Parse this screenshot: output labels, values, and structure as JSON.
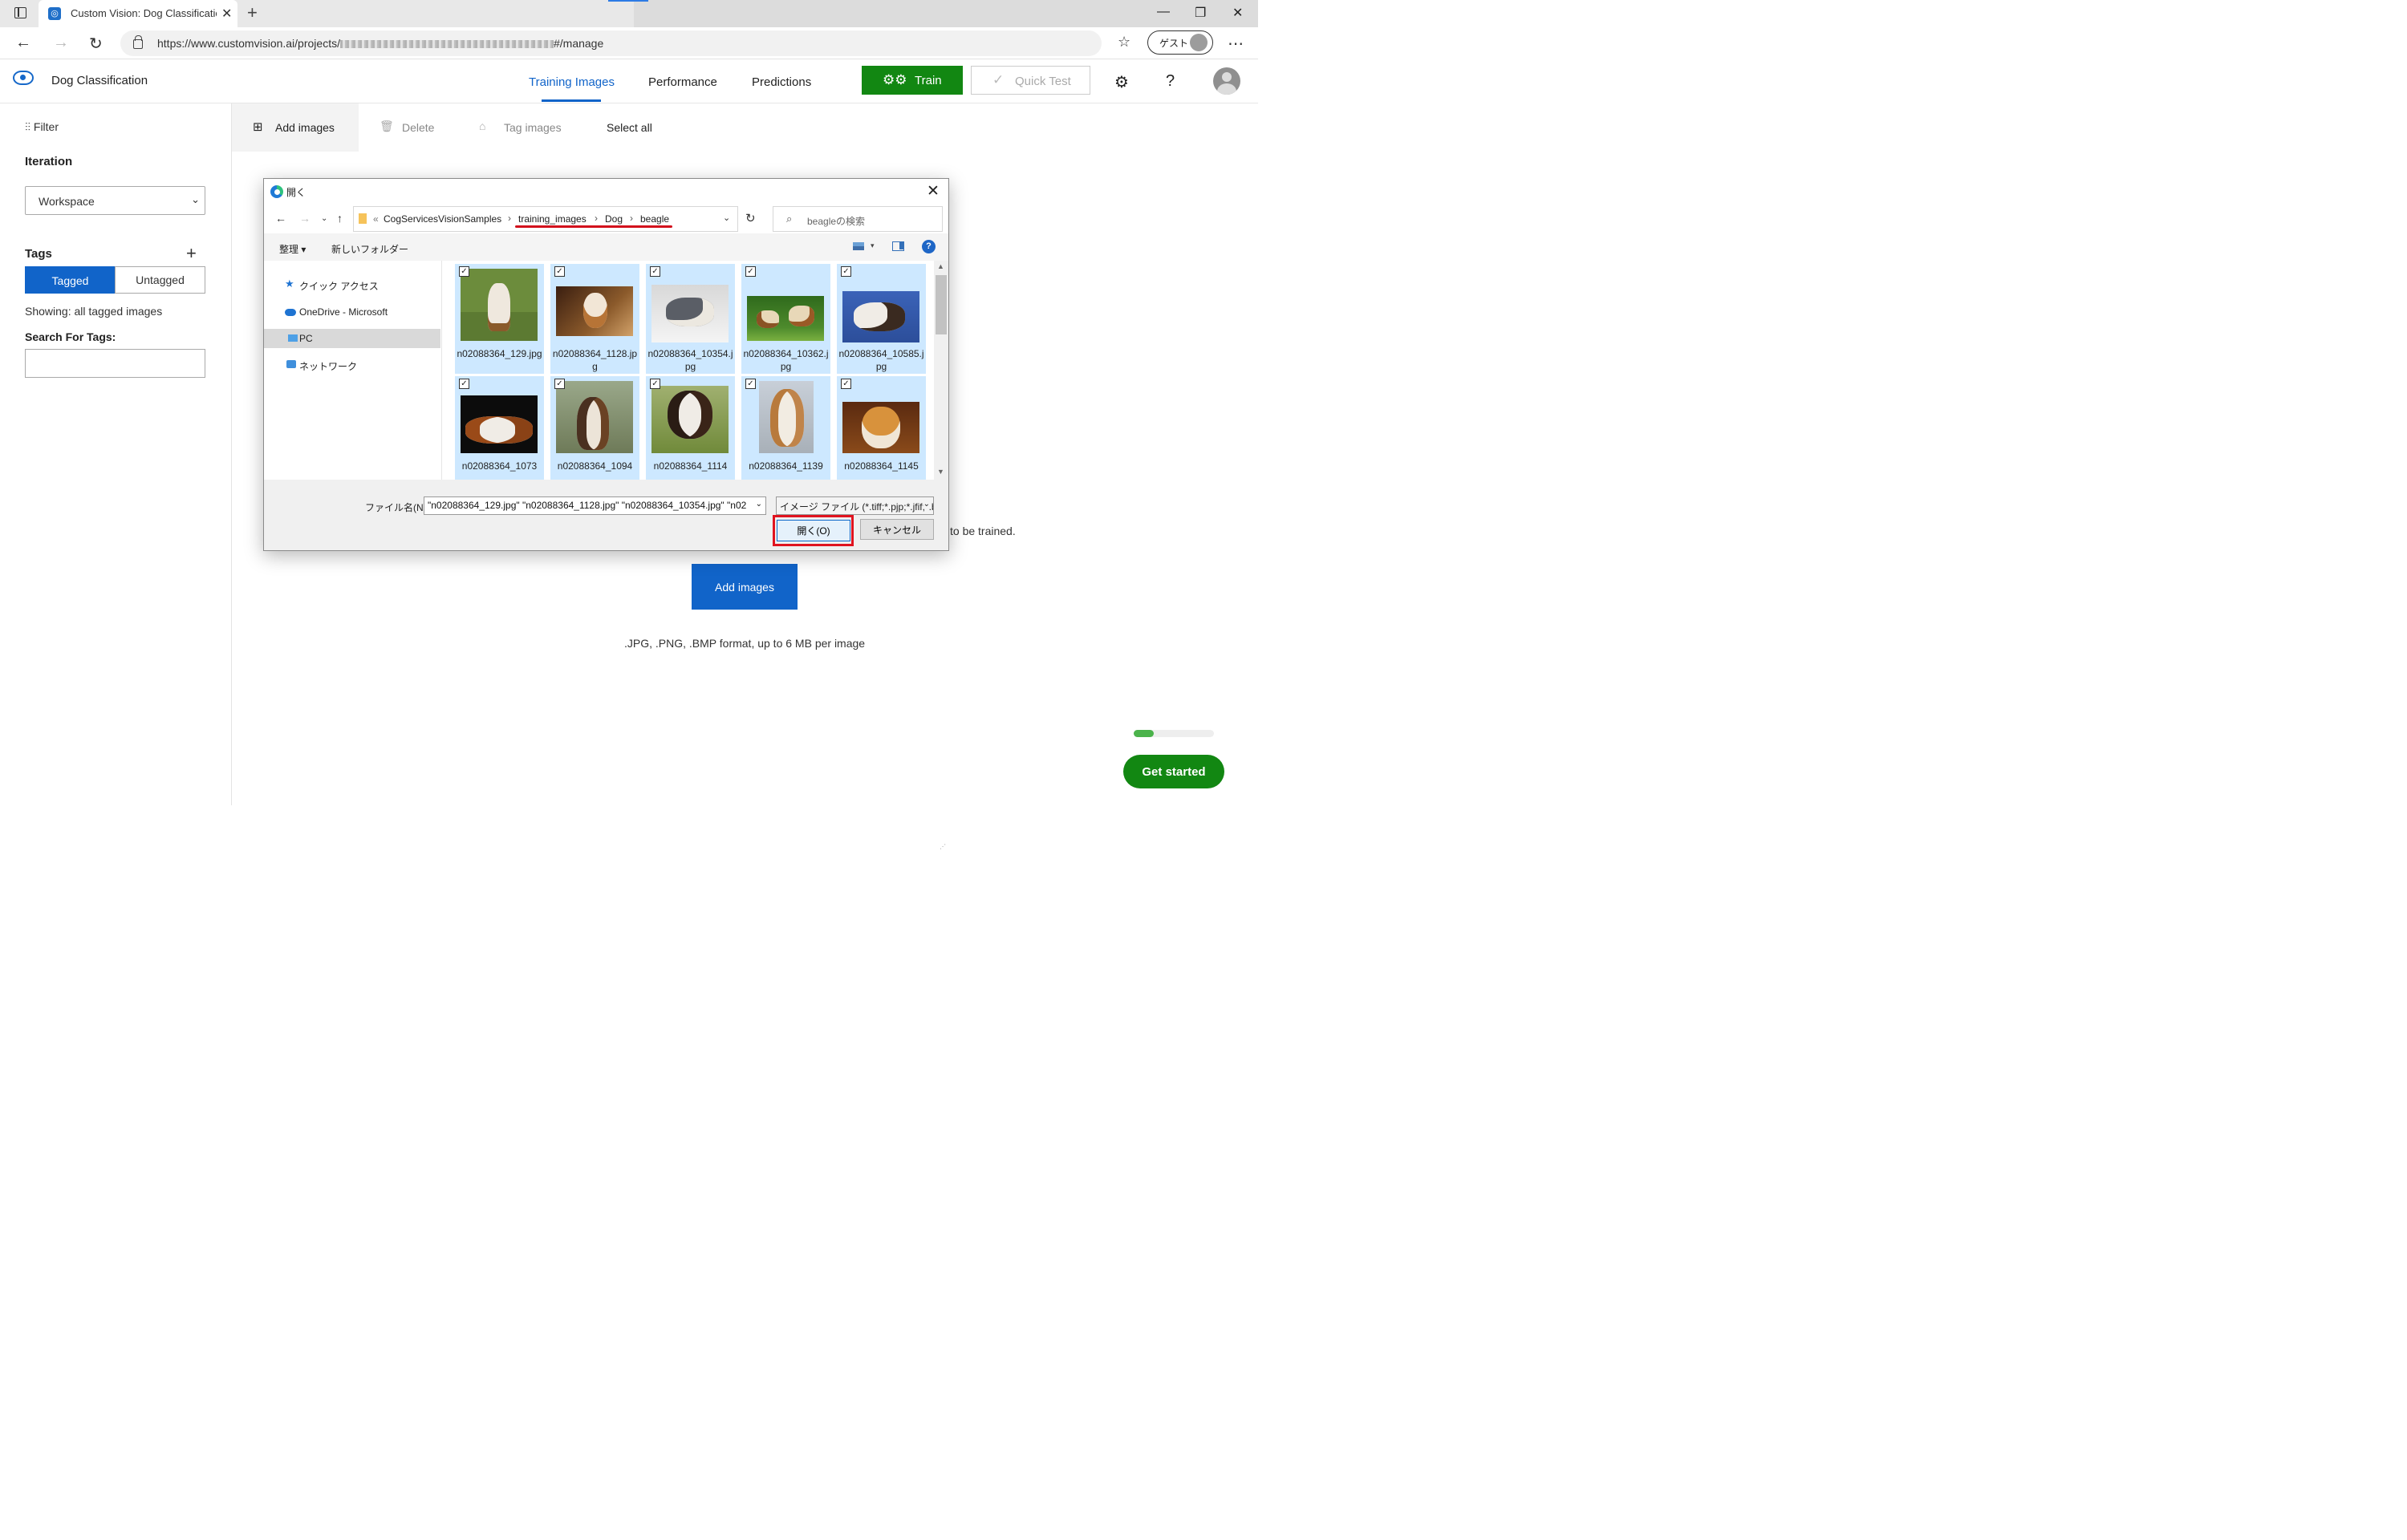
{
  "browser": {
    "tab_title": "Custom Vision: Dog Classification",
    "url_prefix": "https://www.customvision.ai/projects/",
    "url_suffix": "#/manage",
    "guest_label": "ゲスト"
  },
  "app": {
    "project_title": "Dog Classification",
    "nav_tabs": [
      "Training Images",
      "Performance",
      "Predictions"
    ],
    "train_label": "Train",
    "quick_test_label": "Quick Test",
    "help_label": "?"
  },
  "sidebar": {
    "filter_label": "Filter",
    "iteration_heading": "Iteration",
    "iteration_value": "Workspace",
    "tags_heading": "Tags",
    "tagged_label": "Tagged",
    "untagged_label": "Untagged",
    "showing_text": "Showing: all tagged images",
    "search_heading": "Search For Tags:"
  },
  "toolbar": {
    "add_images": "Add images",
    "delete": "Delete",
    "tag_images": "Tag images",
    "select_all": "Select all"
  },
  "main": {
    "trained_text": "to be trained.",
    "add_images_button": "Add images",
    "format_note": ".JPG, .PNG, .BMP format, up to 6 MB per image",
    "get_started": "Get started",
    "progress_fraction": 0.25
  },
  "dialog": {
    "title": "開く",
    "breadcrumb": [
      "«",
      "CogServicesVisionSamples",
      "training_images",
      "Dog",
      "beagle"
    ],
    "search_placeholder": "beagleの検索",
    "organize": "整理",
    "new_folder": "新しいフォルダー",
    "nav_items": [
      "クイック アクセス",
      "OneDrive - Microsoft",
      "PC",
      "ネットワーク"
    ],
    "selected_nav": "PC",
    "files": [
      "n02088364_129.jpg",
      "n02088364_1128.jpg",
      "n02088364_10354.jpg",
      "n02088364_10362.jpg",
      "n02088364_10585.jpg",
      "n02088364_1073",
      "n02088364_1094",
      "n02088364_1114",
      "n02088364_1139",
      "n02088364_1145"
    ],
    "file_name_label": "ファイル名(N):",
    "file_name_value": "\"n02088364_129.jpg\" \"n02088364_1128.jpg\" \"n02088364_10354.jpg\" \"n02",
    "file_type_value": "イメージ ファイル (*.tiff;*.pjp;*.jfif;*.b",
    "open_label": "開く(O)",
    "cancel_label": "キャンセル"
  },
  "colors": {
    "accent_blue": "#1164c9",
    "train_green": "#128712",
    "selection_blue": "#cde8ff",
    "annotation_red": "#e0131f"
  }
}
